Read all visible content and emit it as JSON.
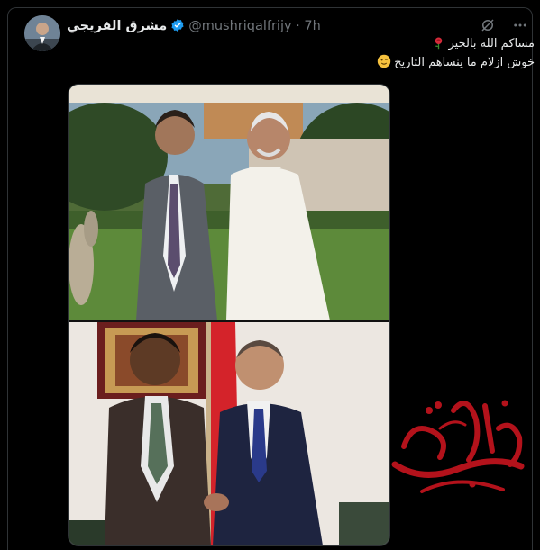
{
  "tweet": {
    "author_name": "مشرق الفريجي",
    "handle": "@mushriqalfrijy",
    "separator": " · ",
    "time": "7h",
    "line1": "مساكم الله بالخير",
    "line2": "خوش ازلام ما ينساهم التاريخ"
  },
  "icons": {
    "verified": "verified-badge-icon",
    "grok": "grok-icon",
    "more": "more-options-icon",
    "rose": "rose-emoji",
    "wink": "winking-face-emoji"
  },
  "colors": {
    "background": "#000000",
    "verified": "#1d9bf0",
    "muted": "#71767b",
    "calligraphy": "#b3121b"
  }
}
